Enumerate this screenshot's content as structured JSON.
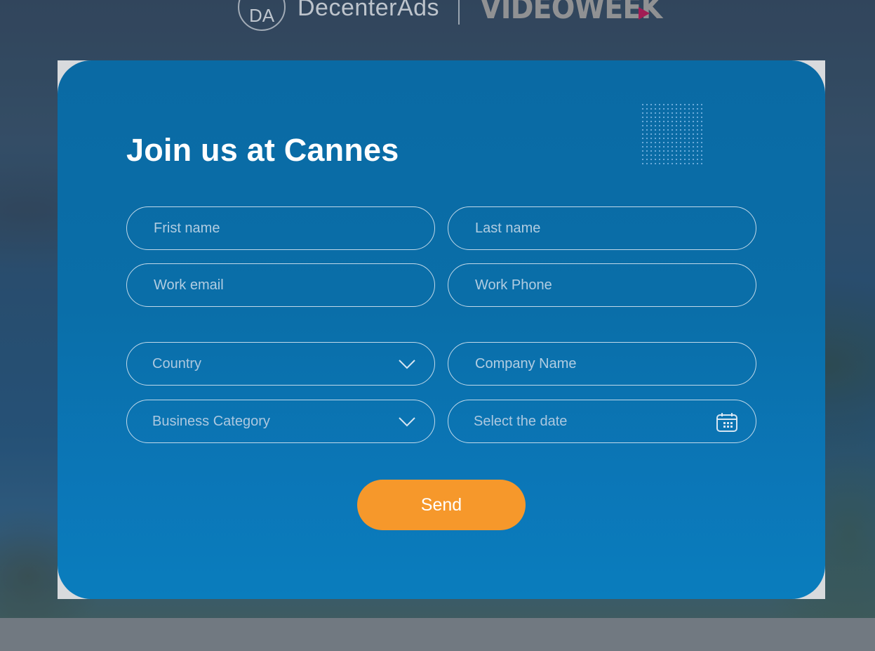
{
  "header": {
    "da_monogram": "DA",
    "da_brand": "DecenterAds",
    "partner_brand": "VIDEOWEEK"
  },
  "form": {
    "title": "Join us at Cannes",
    "first_name_placeholder": "Frist name",
    "last_name_placeholder": "Last name",
    "work_email_placeholder": "Work email",
    "work_phone_placeholder": "Work Phone",
    "country_label": "Country",
    "company_name_placeholder": "Company Name",
    "business_category_label": "Business Category",
    "date_placeholder": "Select the date",
    "send_label": "Send"
  },
  "colors": {
    "modal_blue": "#0a6ea8",
    "send_orange": "#f6982b",
    "partner_accent": "#a21d54"
  },
  "icons": {
    "country": "chevron-down-icon",
    "business_category": "chevron-down-icon",
    "date": "calendar-icon"
  }
}
